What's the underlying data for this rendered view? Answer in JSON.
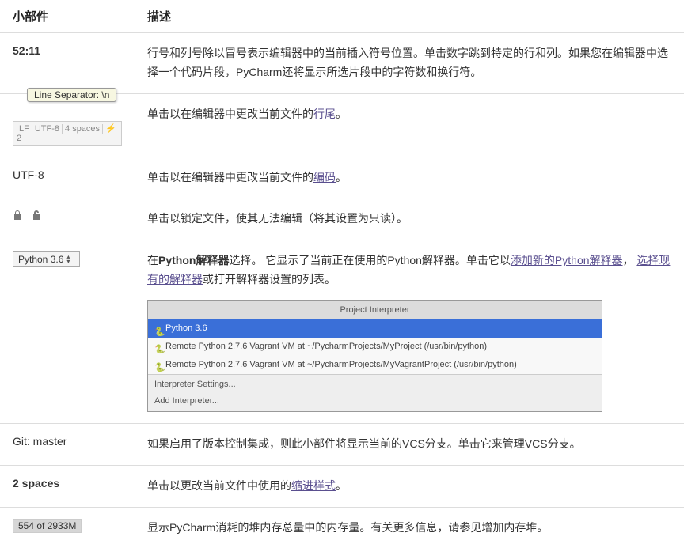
{
  "headers": {
    "widget": "小部件",
    "desc": "描述"
  },
  "rows": {
    "pos": {
      "widget": "52:11",
      "desc": "行号和列号除以冒号表示编辑器中的当前插入符号位置。单击数字跳到特定的行和列。如果您在编辑器中选择一个代码片段，PyCharm还将显示所选片段中的字符数和换行符。"
    },
    "sep": {
      "tooltip": "Line Separator: \\n",
      "status_segments": [
        "LF",
        "UTF-8",
        "4 spaces",
        "⚡ 2"
      ],
      "desc_pre": "单击以在编辑器中更改当前文件的",
      "desc_link": "行尾",
      "desc_post": "。"
    },
    "enc": {
      "widget": "UTF-8",
      "desc_pre": "单击以在编辑器中更改当前文件的",
      "desc_link": "编码",
      "desc_post": "。"
    },
    "lock": {
      "desc": "单击以锁定文件，使其无法编辑（将其设置为只读）。"
    },
    "interp": {
      "dropdown": "Python 3.6",
      "desc_pre": "在",
      "desc_bold": "Python解释器",
      "desc_mid": "选择。 它显示了当前正在使用的Python解释器。单击它以",
      "link1": "添加新的Python解释器",
      "sep1": "，  ",
      "link2": "选择现有的解释器",
      "desc_post": "或打开解释器设置的列表。",
      "popup": {
        "title": "Project Interpreter",
        "selected": "Python 3.6",
        "items": [
          "Remote Python 2.7.6 Vagrant VM at ~/PycharmProjects/MyProject (/usr/bin/python)",
          "Remote Python 2.7.6 Vagrant VM at ~/PycharmProjects/MyVagrantProject (/usr/bin/python)"
        ],
        "settings": "Interpreter Settings...",
        "add": "Add Interpreter..."
      }
    },
    "git": {
      "widget": "Git: master",
      "desc": "如果启用了版本控制集成，则此小部件将显示当前的VCS分支。单击它来管理VCS分支。"
    },
    "indent": {
      "widget": "2 spaces",
      "desc_pre": "单击以更改当前文件中使用的",
      "desc_link": "缩进样式",
      "desc_post": "。"
    },
    "mem": {
      "widget": "554 of 2933M",
      "desc": "显示PyCharm消耗的堆内存总量中的内存量。有关更多信息，请参见增加内存堆。"
    }
  }
}
